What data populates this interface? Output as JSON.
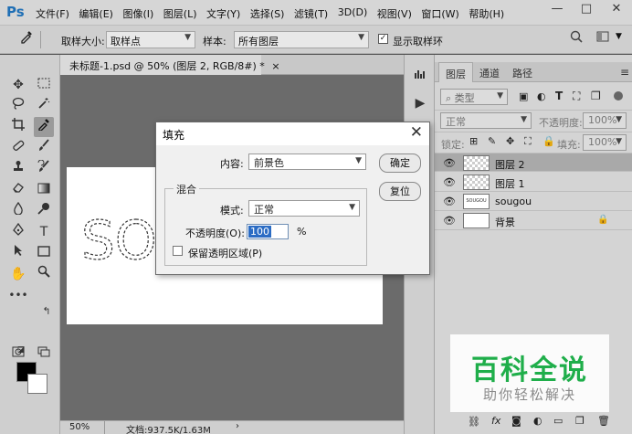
{
  "app": {
    "logo": "Ps"
  },
  "menu": [
    "文件(F)",
    "编辑(E)",
    "图像(I)",
    "图层(L)",
    "文字(Y)",
    "选择(S)",
    "滤镜(T)",
    "3D(D)",
    "视图(V)",
    "窗口(W)",
    "帮助(H)"
  ],
  "window_controls": {
    "minimize": "—",
    "maximize": "□",
    "close": "✕"
  },
  "options": {
    "sample_size_label": "取样大小:",
    "sample_size_value": "取样点",
    "sample_label": "样本:",
    "sample_value": "所有图层",
    "show_ring_label": "显示取样环",
    "show_ring_checked": true
  },
  "document": {
    "tab_title": "未标题-1.psd @ 50% (图层 2, RGB/8#) *",
    "tab_close": "×",
    "zoom": "50%",
    "doc_size": "文档:937.5K/1.63M",
    "canvas_text": "SOUGOU"
  },
  "layers_panel": {
    "tabs": [
      "图层",
      "通道",
      "路径"
    ],
    "filter_label": "类型",
    "blend_mode": "正常",
    "opacity_label": "不透明度:",
    "opacity_value": "100%",
    "lock_label": "锁定:",
    "fill_label": "填充:",
    "fill_value": "100%",
    "layers": [
      {
        "name": "图层 2",
        "selected": true,
        "thumb": "checker"
      },
      {
        "name": "图层 1",
        "selected": false,
        "thumb": "checker"
      },
      {
        "name": "sougou",
        "selected": false,
        "thumb": "text"
      },
      {
        "name": "背景",
        "selected": false,
        "thumb": "white",
        "locked": true
      }
    ]
  },
  "dialog": {
    "title": "填充",
    "content_label": "内容:",
    "content_value": "前景色",
    "ok_label": "确定",
    "reset_label": "复位",
    "blend_group_label": "混合",
    "mode_label": "模式:",
    "mode_value": "正常",
    "opacity_label": "不透明度(O):",
    "opacity_value": "100",
    "opacity_unit": "%",
    "preserve_label": "保留透明区域(P)",
    "preserve_checked": false
  },
  "watermark": {
    "logo": "百科全说",
    "subtitle": "助你轻松解决"
  },
  "colors": {
    "foreground": "#000000",
    "background": "#ffffff",
    "accent": "#1fae4a"
  }
}
